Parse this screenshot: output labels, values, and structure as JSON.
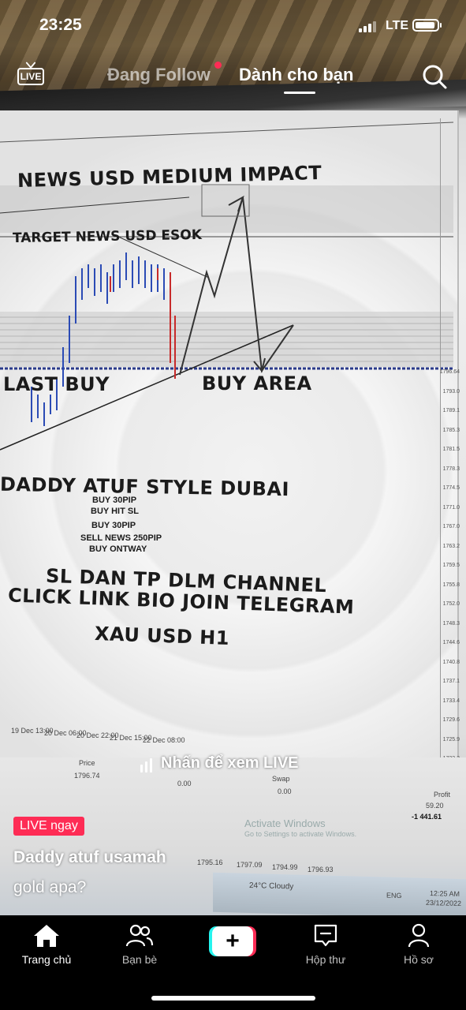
{
  "status_bar": {
    "time": "23:25",
    "network": "LTE"
  },
  "top_nav": {
    "live_label": "LIVE",
    "tabs": [
      {
        "label": "Đang Follow",
        "active": false
      },
      {
        "label": "Dành cho bạn",
        "active": true
      }
    ]
  },
  "video": {
    "chart_overlay": {
      "headline": "NEWS USD MEDIUM IMPACT",
      "target": "TARGET NEWS USD ESOK",
      "last_buy": "LAST BUY",
      "buy_area": "BUY AREA",
      "style": "DADDY ATUF STYLE DUBAI",
      "trades": [
        "BUY 30PIP",
        "BUY HIT SL",
        "BUY 30PIP",
        "SELL NEWS 250PIP",
        "BUY ONTWAY"
      ],
      "sl_tp": "SL DAN TP DLM CHANNEL",
      "click_link": "CLICK LINK BIO JOIN TELEGRAM",
      "symbol": "XAU USD H1",
      "x_ticks": [
        "19 Dec 13:00",
        "20 Dec 06:00",
        "20 Dec 22:00",
        "21 Dec 15:00",
        "22 Dec 08:00"
      ],
      "price_ticks": [
        "1796.64",
        "1793.0",
        "1789.1",
        "1785.3",
        "1781.5",
        "1778.3",
        "1774.5",
        "1771.0",
        "1767.0",
        "1763.2",
        "1759.5",
        "1755.8",
        "1752.0",
        "1748.3",
        "1744.6",
        "1740.8",
        "1737.1",
        "1733.4",
        "1729.6",
        "1725.9",
        "1722.2"
      ],
      "trade_panel": {
        "price_header": "Price",
        "price_val": "1796.74",
        "swap_header": "Swap",
        "zero1": "0.00",
        "zero2": "0.00",
        "profit_header": "Profit",
        "profit1": "59.20",
        "profit2": "-1 441.61",
        "p1": "1795.16",
        "p2": "1797.09",
        "p3": "1794.99",
        "p4": "1796.93",
        "activate": "Activate Windows",
        "activate_sub": "Go to Settings to activate Windows."
      },
      "taskbar": {
        "weather": "24°C Cloudy",
        "lang": "ENG",
        "clock": "12:25 AM",
        "date": "23/12/2022"
      }
    },
    "watch_live": "Nhấn để xem LIVE",
    "live_badge": "LIVE ngay",
    "creator": "Daddy atuf usamah",
    "caption": "gold apa?"
  },
  "bottom_nav": {
    "items": [
      {
        "label": "Trang chủ",
        "active": true
      },
      {
        "label": "Bạn bè",
        "active": false
      },
      {
        "label": "Hộp thư",
        "active": false
      },
      {
        "label": "Hồ sơ",
        "active": false
      }
    ]
  },
  "colors": {
    "accent_red": "#fe2c55",
    "accent_cyan": "#25f4ee",
    "nav_bg": "#000000"
  }
}
